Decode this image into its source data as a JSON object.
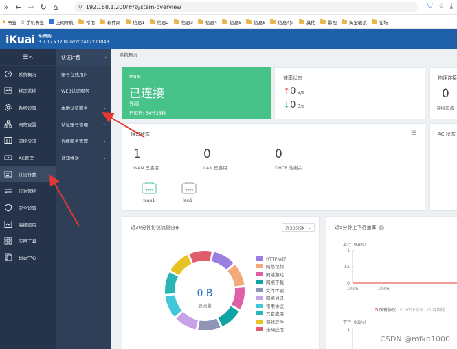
{
  "browser": {
    "url": "192.168.1.200/#/system-overview",
    "bookmarks": [
      "书签",
      "手机书签",
      "上网导航",
      "常用",
      "软件网",
      "信息1",
      "信息2",
      "信息3",
      "信息4",
      "信息5",
      "信息6",
      "信息4抖",
      "其他",
      "影视",
      "淘宝联系",
      "论坛"
    ]
  },
  "header": {
    "logo": "iKuai",
    "edition": "免费版",
    "build": "3.7.17 x32 Build202412271043"
  },
  "sidebar": {
    "items": [
      {
        "label": "系统概况",
        "icon": "dashboard-icon"
      },
      {
        "label": "状态监控",
        "icon": "monitor-icon"
      },
      {
        "label": "系统设置",
        "icon": "gear-icon"
      },
      {
        "label": "网络设置",
        "icon": "network-icon"
      },
      {
        "label": "流控分流",
        "icon": "flow-icon"
      },
      {
        "label": "AC管理",
        "icon": "ac-icon"
      },
      {
        "label": "认证计费",
        "icon": "auth-icon"
      },
      {
        "label": "行为管控",
        "icon": "behavior-icon"
      },
      {
        "label": "安全设置",
        "icon": "shield-icon"
      },
      {
        "label": "高级应用",
        "icon": "advanced-icon"
      },
      {
        "label": "应用工具",
        "icon": "tools-icon"
      },
      {
        "label": "日志中心",
        "icon": "log-icon"
      }
    ]
  },
  "subsidebar": {
    "title": "认证计费",
    "items": [
      "账号在线用户",
      "WEB认证服务",
      "本地认证服务",
      "认证账号管理",
      "代拨服务管理",
      "通知推送"
    ]
  },
  "main": {
    "breadcrumb": "系统概况",
    "status": {
      "brand": "iKuai",
      "state": "已连接",
      "line": "外网",
      "uptime": "已运行: 54分33秒"
    },
    "rate": {
      "title": "速率状态",
      "up": "0",
      "down": "0",
      "unit": "B/s"
    },
    "physical": {
      "title": "物理连接",
      "value": "0",
      "sub": "连接设备"
    },
    "ports": {
      "title": "接口状态",
      "stats": [
        {
          "value": "1",
          "label": "WAN 已启用"
        },
        {
          "value": "0",
          "label": "LAN 已启用"
        },
        {
          "value": "0",
          "label": "DHCP 池剩余"
        }
      ],
      "ifaces": [
        "wan1",
        "lan1"
      ]
    },
    "ac": {
      "title": "AC 状态"
    },
    "traffic": {
      "title": "近30分钟协议流量分布",
      "range": "近30分钟",
      "center_value": "0 B",
      "center_label": "总流量",
      "legend": [
        {
          "name": "HTTP协议",
          "color": "#9b7fe0"
        },
        {
          "name": "网络视频",
          "color": "#f4a97a"
        },
        {
          "name": "网络游戏",
          "color": "#e060a8"
        },
        {
          "name": "网络下载",
          "color": "#0fa3a3"
        },
        {
          "name": "文件传输",
          "color": "#8e95b6"
        },
        {
          "name": "网络通讯",
          "color": "#c7a2e6"
        },
        {
          "name": "常用协议",
          "color": "#42c6d9"
        },
        {
          "name": "其它应用",
          "color": "#2bb5b5"
        },
        {
          "name": "游戏软件",
          "color": "#e6c321"
        },
        {
          "name": "未知应用",
          "color": "#e25b6a"
        }
      ]
    },
    "speed": {
      "title": "近5分钟上下行速率",
      "up_label": "上行（KB/s）",
      "down_label": "下行（KB/s）",
      "yticks": [
        "1",
        "0.5",
        "0"
      ],
      "xticks": [
        "10:05",
        "10:06"
      ],
      "legend": [
        "所有协议",
        "HTTP协议",
        "网络视"
      ]
    }
  },
  "watermark": "CSDN @mfkd1000"
}
